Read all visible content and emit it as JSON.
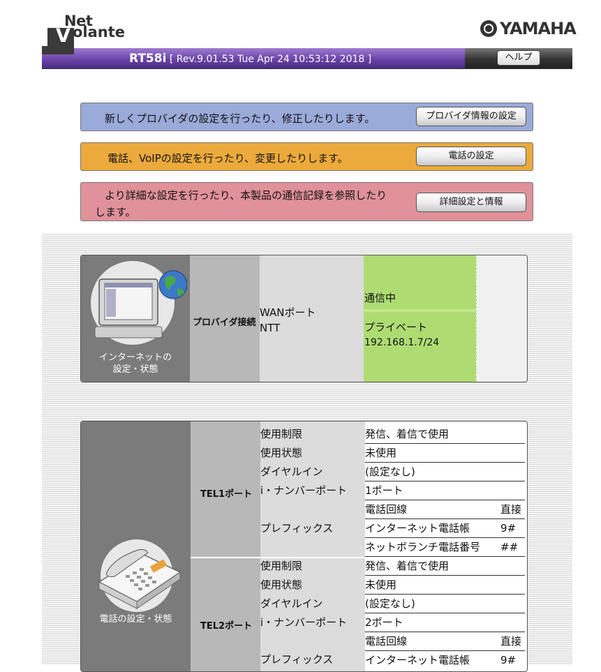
{
  "header": {
    "logo_net": "Net",
    "logo_olante": "olante",
    "brand": "YAMAHA",
    "model": "RT58i",
    "revision": "[ Rev.9.01.53 Tue Apr 24 10:53:12 2018 ]",
    "help_label": "ヘルプ"
  },
  "nav": [
    {
      "text": "新しくプロバイダの設定を行ったり、修正したりします。",
      "button": "プロバイダ情報の設定",
      "color": "#9aaad9"
    },
    {
      "text": "電話、VoIPの設定を行ったり、変更したりします。",
      "button": "電話の設定",
      "color": "#ebaa3b"
    },
    {
      "text": "より詳細な設定を行ったり、本製品の通信記録を参照したりします。",
      "text_line1": "より詳細な設定を行ったり、本製品の通信記録を参照したり",
      "text_line2": "します。",
      "button": "詳細設定と情報",
      "color": "#e0919a"
    }
  ],
  "internet": {
    "icon_label_1": "インターネットの",
    "icon_label_2": "設定・状態",
    "connection_label": "プロバイダ接続",
    "port": "WANポート",
    "provider": "NTT",
    "status": "通信中",
    "address_type": "プライベート",
    "address": "192.168.1.7/24"
  },
  "phone": {
    "icon_label": "電話の設定・状態",
    "ports": [
      {
        "name": "TEL1ポート",
        "rows": [
          {
            "label": "使用制限",
            "value": "発信、着信で使用"
          },
          {
            "label": "使用状態",
            "value": "未使用"
          },
          {
            "label": "ダイヤルイン",
            "value": "(設定なし)"
          },
          {
            "label": "i・ナンバーポート",
            "value": "1ポート"
          }
        ],
        "prefix_label": "プレフィックス",
        "prefix": [
          {
            "name": "電話回線",
            "value": "直接"
          },
          {
            "name": "インターネット電話帳",
            "value": "9#"
          },
          {
            "name": "ネットボランチ電話番号",
            "value": "##"
          }
        ]
      },
      {
        "name": "TEL2ポート",
        "rows": [
          {
            "label": "使用制限",
            "value": "発信、着信で使用"
          },
          {
            "label": "使用状態",
            "value": "未使用"
          },
          {
            "label": "ダイヤルイン",
            "value": "(設定なし)"
          },
          {
            "label": "i・ナンバーポート",
            "value": "2ポート"
          }
        ],
        "prefix_label": "プレフィックス",
        "prefix": [
          {
            "name": "電話回線",
            "value": "直接"
          },
          {
            "name": "インターネット電話帳",
            "value": "9#"
          }
        ]
      }
    ]
  }
}
